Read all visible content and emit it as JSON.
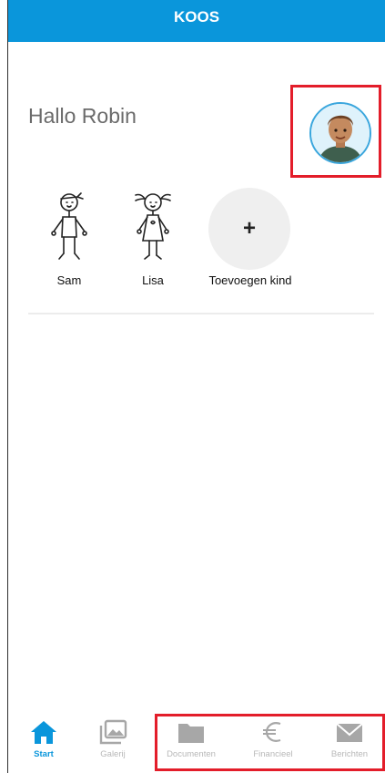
{
  "header": {
    "title": "KOOS"
  },
  "greeting": "Hallo Robin",
  "kids": [
    {
      "name": "Sam",
      "icon": "boy-stick-figure-icon"
    },
    {
      "name": "Lisa",
      "icon": "girl-stick-figure-icon"
    }
  ],
  "add_kid": {
    "symbol": "+",
    "label": "Toevoegen kind"
  },
  "tabs": [
    {
      "label": "Start",
      "icon": "home-icon",
      "active": true
    },
    {
      "label": "Galerij",
      "icon": "gallery-icon",
      "active": false
    },
    {
      "label": "Documenten",
      "icon": "folder-icon",
      "active": false
    },
    {
      "label": "Financieel",
      "icon": "euro-icon",
      "active": false
    },
    {
      "label": "Berichten",
      "icon": "envelope-icon",
      "active": false
    }
  ],
  "colors": {
    "header": "#0a96db",
    "accent": "#0a96db",
    "inactive_tab": "#b8b8b8",
    "highlight": "#e31d2a"
  }
}
